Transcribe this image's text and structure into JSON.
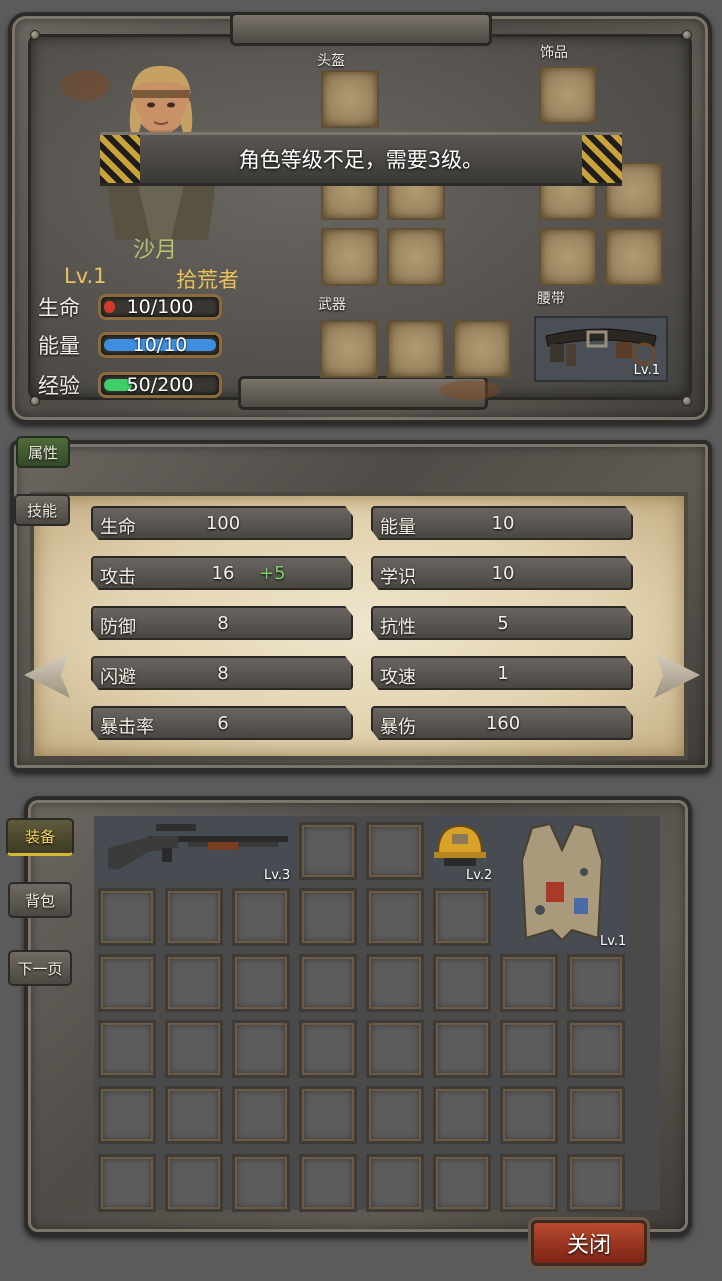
{
  "character": {
    "name": "沙月",
    "level": "Lv.1",
    "class": "拾荒者",
    "stats": [
      {
        "label": "生命",
        "value": "10/100",
        "fill": 0.1,
        "color": "#d23a2c"
      },
      {
        "label": "能量",
        "value": "10/10",
        "fill": 1.0,
        "color": "#3f8fe0"
      },
      {
        "label": "经验",
        "value": "50/200",
        "fill": 0.25,
        "color": "#3fcf6a"
      }
    ]
  },
  "message": "角色等级不足，需要3级。",
  "slots": {
    "helmet": "头盔",
    "accessory": "饰品",
    "weapon": "武器",
    "belt": "腰带",
    "belt_level": "Lv.1"
  },
  "tabs": {
    "attributes": "属性",
    "skills": "技能"
  },
  "attributes": [
    {
      "name": "生命",
      "value": "100",
      "bonus": ""
    },
    {
      "name": "能量",
      "value": "10",
      "bonus": ""
    },
    {
      "name": "攻击",
      "value": "16",
      "bonus": "+5"
    },
    {
      "name": "学识",
      "value": "10",
      "bonus": ""
    },
    {
      "name": "防御",
      "value": "8",
      "bonus": ""
    },
    {
      "name": "抗性",
      "value": "5",
      "bonus": ""
    },
    {
      "name": "闪避",
      "value": "8",
      "bonus": ""
    },
    {
      "name": "攻速",
      "value": "1",
      "bonus": ""
    },
    {
      "name": "暴击率",
      "value": "6",
      "bonus": ""
    },
    {
      "name": "暴伤",
      "value": "160",
      "bonus": ""
    }
  ],
  "inventory_tabs": {
    "equip": "装备",
    "bag": "背包",
    "next_page": "下一页"
  },
  "items": {
    "gun_level": "Lv.3",
    "helmet_level": "Lv.2",
    "vest_level": "Lv.1"
  },
  "close_label": "关闭"
}
